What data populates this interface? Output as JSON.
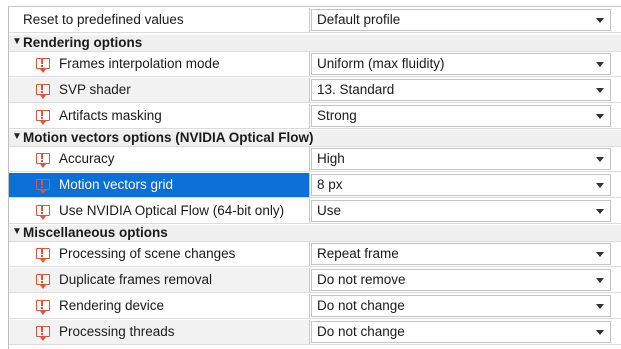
{
  "top_row": {
    "label": "Reset to predefined values",
    "value": "Default profile"
  },
  "sections": [
    {
      "title": "Rendering options",
      "rows": [
        {
          "label": "Frames interpolation mode",
          "value": "Uniform (max fluidity)"
        },
        {
          "label": "SVP shader",
          "value": "13. Standard"
        },
        {
          "label": "Artifacts masking",
          "value": "Strong"
        }
      ]
    },
    {
      "title": "Motion vectors options (NVIDIA Optical Flow)",
      "rows": [
        {
          "label": "Accuracy",
          "value": "High"
        },
        {
          "label": "Motion vectors grid",
          "value": "8 px"
        },
        {
          "label": "Use NVIDIA Optical Flow (64-bit only)",
          "value": "Use"
        }
      ]
    },
    {
      "title": "Miscellaneous options",
      "rows": [
        {
          "label": "Processing of scene changes",
          "value": "Repeat frame"
        },
        {
          "label": "Duplicate frames removal",
          "value": "Do not remove"
        },
        {
          "label": "Rendering device",
          "value": "Do not change"
        },
        {
          "label": "Processing threads",
          "value": "Do not change"
        }
      ]
    }
  ],
  "icons": {
    "section_toggle": "collapse-arrow-icon",
    "row_icon": "warning-comment-icon"
  },
  "colors": {
    "selection": "#0a6fd6",
    "icon": "#d9573f",
    "section_bg": "#f0f0f0"
  }
}
